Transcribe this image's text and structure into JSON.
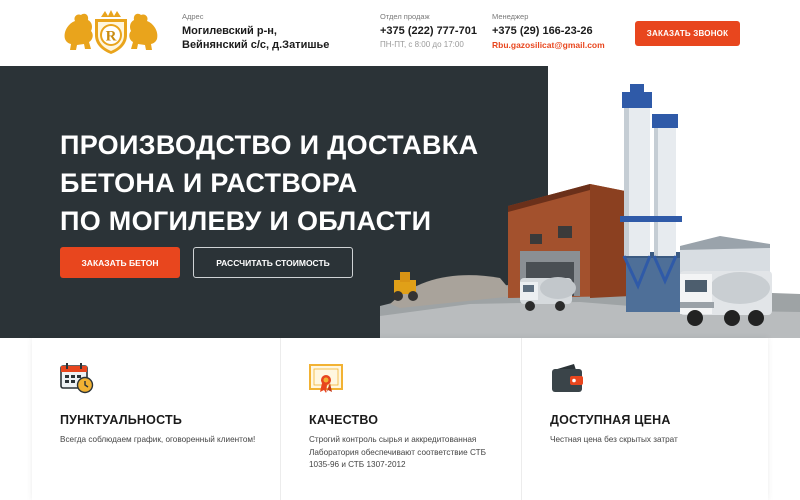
{
  "header": {
    "address_label": "Адрес",
    "address_line1": "Могилевский р-н,",
    "address_line2": "Вейнянский с/с, д.Затишье",
    "sales_label": "Отдел продаж",
    "sales_phone": "+375 (222) 777-701",
    "sales_hours": "ПН-ПТ, с 8:00 до 17:00",
    "manager_label": "Менеджер",
    "manager_phone": "+375 (29) 166-23-26",
    "manager_email": "Rbu.gazosilicat@gmail.com",
    "call_button": "ЗАКАЗАТЬ ЗВОНОК",
    "logo_letter": "R"
  },
  "hero": {
    "title_lines": [
      "ПРОИЗВОДСТВО И ДОСТАВКА",
      "БЕТОНА И РАСТВОРА",
      "ПО МОГИЛЕВУ И ОБЛАСТИ"
    ],
    "order_button": "ЗАКАЗАТЬ БЕТОН",
    "calc_button": "РАССЧИТАТЬ СТОИМОСТЬ"
  },
  "features": [
    {
      "icon": "calendar-clock-icon",
      "title": "ПУНКТУАЛЬНОСТЬ",
      "text": "Всегда соблюдаем график, оговоренный клиентом!"
    },
    {
      "icon": "certificate-icon",
      "title": "КАЧЕСТВО",
      "text": "Строгий контроль сырья и аккредитованная Лаборатория обеспечивают соответствие СТБ 1035-96 и СТБ 1307-2012"
    },
    {
      "icon": "wallet-icon",
      "title": "ДОСТУПНАЯ ЦЕНА",
      "text": "Честная цена без скрытых затрат"
    }
  ],
  "colors": {
    "accent": "#e8461e",
    "hero_bg": "#2b3337",
    "gold": "#e9a41c"
  }
}
